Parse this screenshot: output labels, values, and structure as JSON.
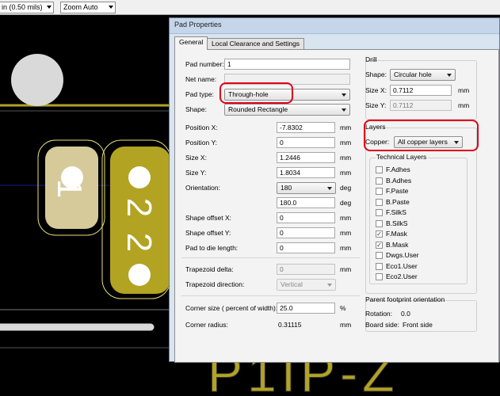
{
  "toolbar": {
    "grid_select": "in (0.50 mils)",
    "zoom_select": "Zoom Auto"
  },
  "canvas": {
    "pad1_label": "1",
    "pad2_label": "2",
    "pad2b_label": "2",
    "ref_text": "P1IP-Z",
    "colors": {
      "copper": "#b2a323",
      "copper_light": "#d6ca9a",
      "hole": "#ffffff",
      "pad_outline": "#e7e17b"
    }
  },
  "dialog": {
    "title": "Pad Properties",
    "tabs": [
      "General",
      "Local Clearance and Settings"
    ],
    "left": {
      "pad_number_label": "Pad number:",
      "pad_number": "1",
      "net_name_label": "Net name:",
      "net_name": "",
      "pad_type_label": "Pad type:",
      "pad_type": "Through-hole",
      "shape_label": "Shape:",
      "shape": "Rounded Rectangle",
      "position_x_label": "Position X:",
      "position_x": "-7.8302",
      "position_x_unit": "mm",
      "position_y_label": "Position Y:",
      "position_y": "0",
      "position_y_unit": "mm",
      "size_x_label": "Size X:",
      "size_x": "1.2446",
      "size_x_unit": "mm",
      "size_y_label": "Size Y:",
      "size_y": "1.8034",
      "size_y_unit": "mm",
      "orientation_label": "Orientation:",
      "orientation": "180",
      "orientation_unit": "deg",
      "orientation_value": "180.0",
      "orientation_value_unit": "deg",
      "shape_offset_x_label": "Shape offset X:",
      "shape_offset_x": "0",
      "shape_offset_x_unit": "mm",
      "shape_offset_y_label": "Shape offset Y:",
      "shape_offset_y": "0",
      "shape_offset_y_unit": "mm",
      "pad_to_die_label": "Pad to die length:",
      "pad_to_die": "0",
      "pad_to_die_unit": "mm",
      "trap_delta_label": "Trapezoid delta:",
      "trap_delta": "0",
      "trap_delta_unit": "mm",
      "trap_dir_label": "Trapezoid direction:",
      "trap_dir": "Vertical",
      "corner_size_label": "Corner size ( percent of width):",
      "corner_size": "25.0",
      "corner_size_unit": "%",
      "corner_radius_label": "Corner radius:",
      "corner_radius": "0.31115",
      "corner_radius_unit": "mm"
    },
    "drill": {
      "title": "Drill",
      "shape_label": "Shape:",
      "shape": "Circular hole",
      "size_x_label": "Size X:",
      "size_x": "0.7112",
      "size_x_unit": "mm",
      "size_y_label": "Size Y:",
      "size_y": "0.7112",
      "size_y_unit": "mm"
    },
    "layers": {
      "title": "Layers",
      "copper_label": "Copper:",
      "copper": "All copper layers",
      "technical_title": "Technical Layers",
      "items": [
        {
          "label": "F.Adhes",
          "checked": false
        },
        {
          "label": "B.Adhes",
          "checked": false
        },
        {
          "label": "F.Paste",
          "checked": false
        },
        {
          "label": "B.Paste",
          "checked": false
        },
        {
          "label": "F.SilkS",
          "checked": false
        },
        {
          "label": "B.SilkS",
          "checked": false
        },
        {
          "label": "F.Mask",
          "checked": true
        },
        {
          "label": "B.Mask",
          "checked": true
        },
        {
          "label": "Dwgs.User",
          "checked": false
        },
        {
          "label": "Eco1.User",
          "checked": false
        },
        {
          "label": "Eco2.User",
          "checked": false
        }
      ]
    },
    "parent": {
      "title": "Parent footprint orientation",
      "rotation_label": "Rotation:",
      "rotation": "0.0",
      "board_side_label": "Board side:",
      "board_side": "Front side"
    }
  }
}
